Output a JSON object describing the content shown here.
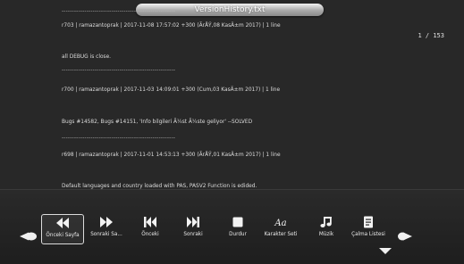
{
  "window": {
    "title": "VersionHistory.txt",
    "page_indicator": "1 / 153"
  },
  "document": {
    "lines": [
      {
        "text": "-------------------------------------------------------"
      },
      {
        "text": "r703 | ramazantoprak | 2017-11-08 17:57:02 +300 (ÃrÅŸ,08 KasÄ±m 2017) | 1 line"
      },
      {
        "text": "all DEBUG is close."
      },
      {
        "text": "-------------------------------------------------------"
      },
      {
        "text": "r700 | ramazantoprak | 2017-11-03 14:09:01 +300 (Cum,03 KasÄ±m 2017) | 1 line"
      },
      {
        "text": "Bugs #14582, Bugs #14151, 'Info bilgileri Ã¼st Ã¼ste geliyor' --SOLVED"
      },
      {
        "text": "-------------------------------------------------------"
      },
      {
        "text": "r698 | ramazantoprak | 2017-11-01 14:53:13 +300 (ÃrÅŸ,01 KasÄ±m 2017) | 1 line"
      },
      {
        "text": "Default languages and country loaded with PAS, PASV2 Function is edided."
      }
    ]
  },
  "toolbar": {
    "buttons": [
      {
        "label": "Önceki Sayfa",
        "icon": "rewind-icon"
      },
      {
        "label": "Sonraki Sa...",
        "icon": "fast-forward-icon"
      },
      {
        "label": "Önceki",
        "icon": "skip-previous-icon"
      },
      {
        "label": "Sonraki",
        "icon": "skip-next-icon"
      },
      {
        "label": "Durdur",
        "icon": "stop-icon"
      },
      {
        "label": "Karakter Seti",
        "icon": "font-icon"
      },
      {
        "label": "Müzik",
        "icon": "music-note-icon"
      },
      {
        "label": "Çalma Listesi",
        "icon": "playlist-icon"
      }
    ],
    "icon_glyph_font": "Aa",
    "colors": {
      "icon": "#f2f2f2",
      "selected_border": "#dcdcdc"
    }
  }
}
